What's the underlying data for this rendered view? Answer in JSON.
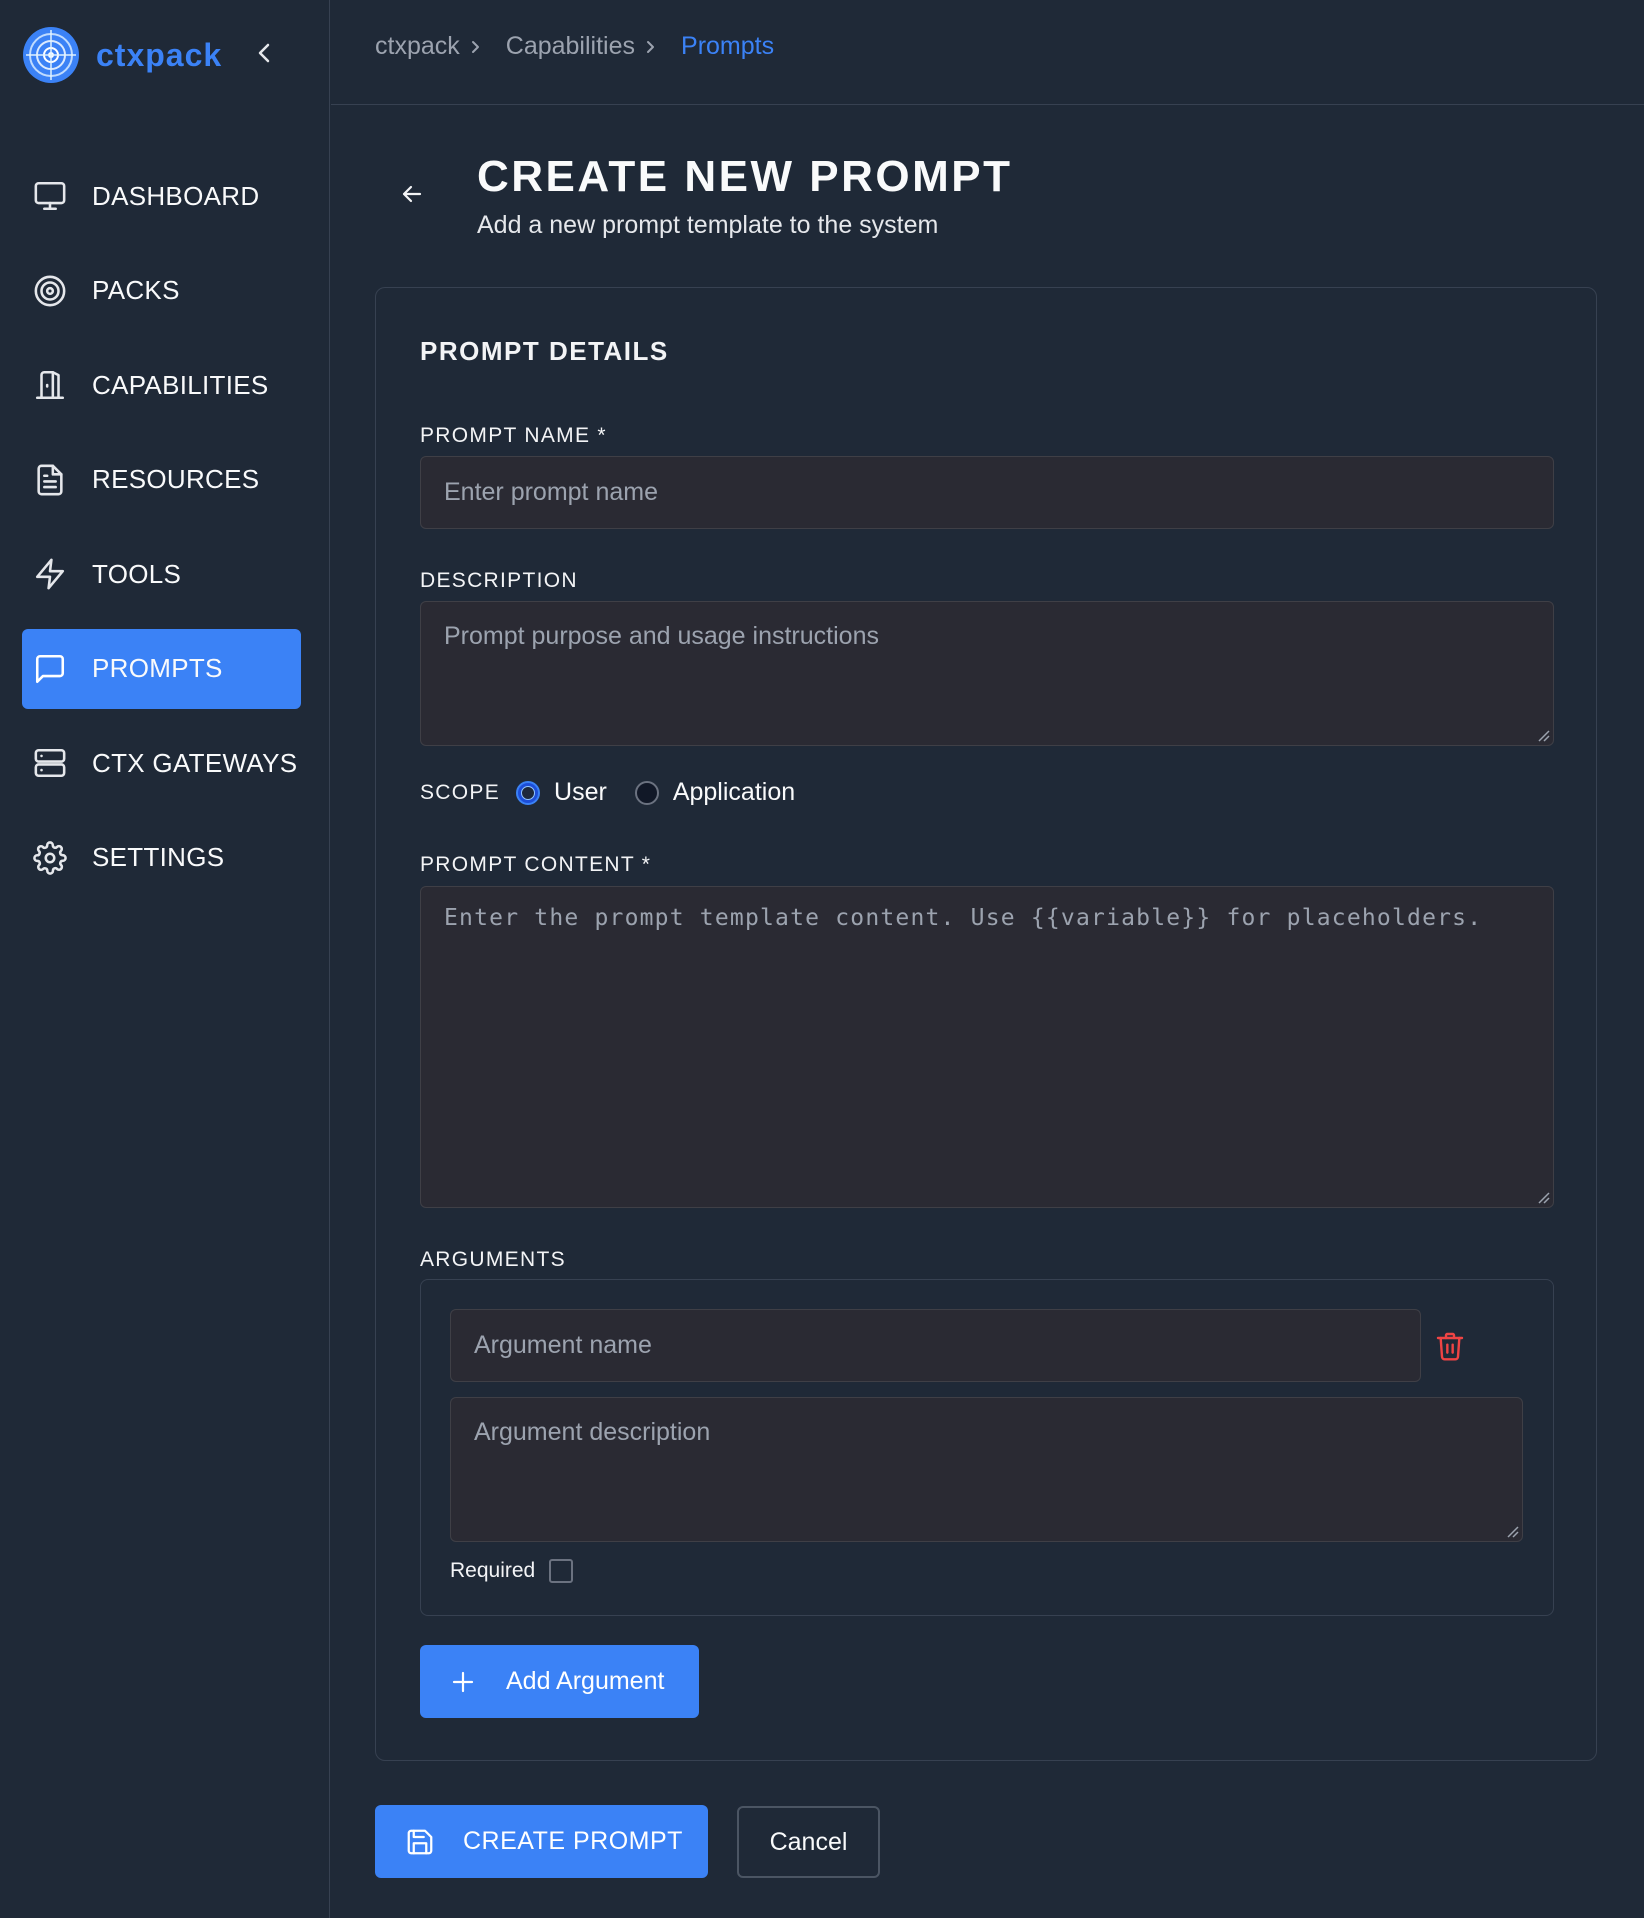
{
  "brand": {
    "name": "ctxpack",
    "logo_icon": "target-logo-icon",
    "collapse_icon": "chevron-left-icon"
  },
  "sidebar": {
    "items": [
      {
        "label": "DASHBOARD",
        "icon": "monitor-icon",
        "active": false
      },
      {
        "label": "PACKS",
        "icon": "target-icon",
        "active": false
      },
      {
        "label": "CAPABILITIES",
        "icon": "door-icon",
        "active": false
      },
      {
        "label": "RESOURCES",
        "icon": "file-text-icon",
        "active": false
      },
      {
        "label": "TOOLS",
        "icon": "lightning-icon",
        "active": false
      },
      {
        "label": "PROMPTS",
        "icon": "message-square-icon",
        "active": true
      },
      {
        "label": "CTX GATEWAYS",
        "icon": "server-icon",
        "active": false
      },
      {
        "label": "SETTINGS",
        "icon": "gear-icon",
        "active": false
      }
    ]
  },
  "breadcrumb": {
    "items": [
      "ctxpack",
      "Capabilities",
      "Prompts"
    ]
  },
  "page": {
    "title": "CREATE NEW PROMPT",
    "subtitle": "Add a new prompt template to the system"
  },
  "form": {
    "section_title": "PROMPT DETAILS",
    "prompt_name": {
      "label": "PROMPT NAME *",
      "placeholder": "Enter prompt name",
      "value": ""
    },
    "description": {
      "label": "DESCRIPTION",
      "placeholder": "Prompt purpose and usage instructions",
      "value": ""
    },
    "scope": {
      "label": "SCOPE",
      "options": [
        "User",
        "Application"
      ],
      "selected": "User"
    },
    "prompt_content": {
      "label": "PROMPT CONTENT *",
      "placeholder": "Enter the prompt template content. Use {{variable}} for placeholders.",
      "value": ""
    },
    "arguments": {
      "label": "ARGUMENTS",
      "items": [
        {
          "name_placeholder": "Argument name",
          "description_placeholder": "Argument description",
          "required_label": "Required",
          "required": false
        }
      ],
      "add_label": "Add Argument"
    }
  },
  "actions": {
    "create_label": "CREATE PROMPT",
    "cancel_label": "Cancel"
  },
  "colors": {
    "accent": "#3b82f6",
    "background": "#1f2937",
    "danger": "#ef4444",
    "input_bg": "#2a2a33"
  }
}
